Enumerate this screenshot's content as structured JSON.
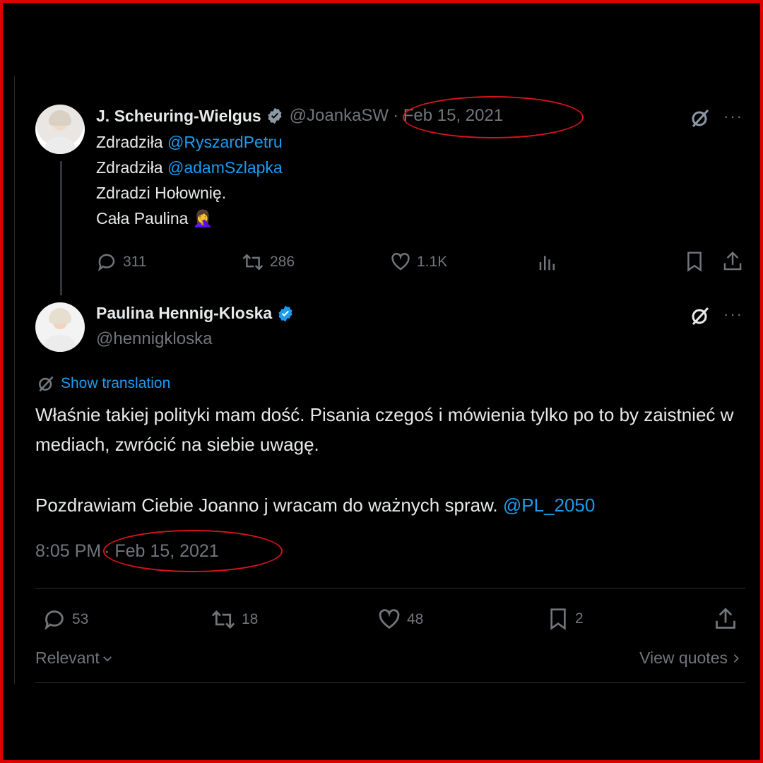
{
  "quoted_tweet": {
    "author_name": "J. Scheuring-Wielgus",
    "handle": "@JoankaSW",
    "date": "· Feb 15, 2021",
    "lines": [
      {
        "text": "Zdradziła ",
        "mention": "@RyszardPetru"
      },
      {
        "text": "Zdradziła ",
        "mention": "@adamSzlapka"
      },
      {
        "text": "Zdradzi Hołownię.",
        "mention": ""
      },
      {
        "text": "Cała Paulina 🤦‍♀️",
        "mention": ""
      }
    ],
    "stats": {
      "replies": "311",
      "reposts": "286",
      "likes": "1.1K"
    }
  },
  "main_tweet": {
    "author_name": "Paulina Hennig-Kloska",
    "handle": "@hennigkloska",
    "show_translation": "Show translation",
    "paragraph1": "Właśnie takiej polityki mam dość. Pisania czegoś i mówienia tylko po to by zaistnieć w mediach, zwrócić na siebie uwagę.",
    "paragraph2": "Pozdrawiam Ciebie Joanno j wracam do ważnych spraw. ",
    "mention": "@PL_2050",
    "time": "8:05 PM",
    "date": "· Feb 15, 2021",
    "stats": {
      "replies": "53",
      "reposts": "18",
      "likes": "48",
      "bookmarks": "2"
    },
    "sort_label": "Relevant",
    "view_quotes": "View quotes"
  },
  "more_glyph": "···",
  "colors": {
    "background": "#000000",
    "text": "#e7e9ea",
    "muted": "#71767b",
    "link": "#1d9bf0",
    "annotation": "#d8141c",
    "frame": "#e00000"
  }
}
